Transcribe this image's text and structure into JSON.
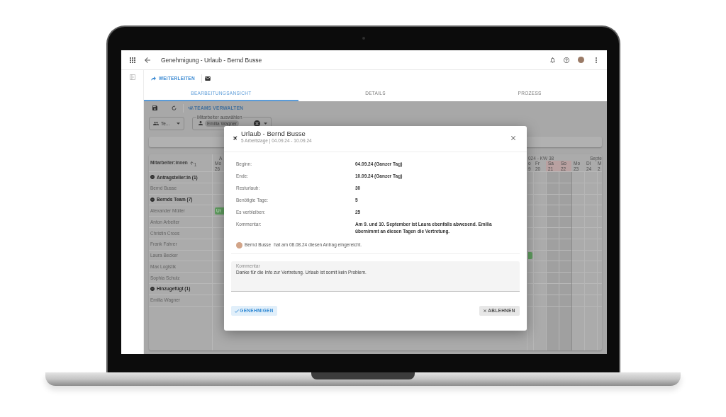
{
  "app_bar": {
    "title": "Genehmigung - Urlaub - Bernd Busse"
  },
  "actions": {
    "forward": "WEITERLEITEN"
  },
  "tabs": [
    {
      "label": "BEARBEITUNGSANSICHT",
      "selected": true
    },
    {
      "label": "DETAILS",
      "selected": false
    },
    {
      "label": "PROZESS",
      "selected": false
    }
  ],
  "toolbar": {
    "manage_teams": "TEAMS VERWALTEN"
  },
  "filters": {
    "team_select": {
      "value": "Te..."
    },
    "employee_select": {
      "label": "Mitarbeiter auswählen",
      "chips": [
        "Emilia Wagner"
      ]
    }
  },
  "table": {
    "column_header": {
      "label": "Mitarbeiter:innen",
      "sort_order": "1"
    },
    "calendar_left": {
      "month": "A",
      "days": [
        {
          "day": "Mo",
          "date": "26",
          "weekend": false
        }
      ]
    },
    "calendar_right": {
      "week": "024 - KW 38",
      "month": "Septe",
      "days": [
        {
          "day": "o",
          "date": "9",
          "weekend": false
        },
        {
          "day": "Fr",
          "date": "20",
          "weekend": false
        },
        {
          "day": "Sa",
          "date": "21",
          "weekend": true
        },
        {
          "day": "So",
          "date": "22",
          "weekend": true
        },
        {
          "day": "Mo",
          "date": "23",
          "weekend": false
        },
        {
          "day": "Di",
          "date": "24",
          "weekend": false
        },
        {
          "day": "M",
          "date": "2",
          "weekend": false
        }
      ]
    },
    "rows": [
      {
        "kind": "group",
        "label": "Antragsteller:in (1)",
        "expanded": true
      },
      {
        "kind": "person",
        "label": "Bernd Busse"
      },
      {
        "kind": "group",
        "label": "Bernds Team (7)",
        "expanded": true
      },
      {
        "kind": "person",
        "label": "Alexander Müller",
        "events": [
          {
            "kind": "start",
            "label": "Ur"
          }
        ]
      },
      {
        "kind": "person",
        "label": "Anton Arbeiter"
      },
      {
        "kind": "person",
        "label": "Christin Croos"
      },
      {
        "kind": "person",
        "label": "Frank Fahrer"
      },
      {
        "kind": "person",
        "label": "Laura Becker",
        "events": [
          {
            "kind": "end"
          }
        ]
      },
      {
        "kind": "person",
        "label": "Max Logistik"
      },
      {
        "kind": "person",
        "label": "Sophia Schulz"
      },
      {
        "kind": "group",
        "label": "Hinzugefügt (1)",
        "expanded": true
      },
      {
        "kind": "person",
        "label": "Emilia Wagner"
      }
    ]
  },
  "dialog": {
    "title": "Urlaub - Bernd Busse",
    "subtitle": "5 Arbeitstage | 04.09.24 - 10.09.24",
    "fields": [
      {
        "label": "Beginn:",
        "value": "04.09.24 (Ganzer Tag)"
      },
      {
        "label": "Ende:",
        "value": "10.09.24 (Ganzer Tag)"
      },
      {
        "label": "Resturlaub:",
        "value": "30"
      },
      {
        "label": "Benötigte Tage:",
        "value": "5"
      },
      {
        "label": "Es verbleiben:",
        "value": "25"
      },
      {
        "label": "Kommentar:",
        "value": "Am 9. und 10. September ist Laura ebenfalls abwesend. Emilia übernimmt an diesen Tagen die Vertretung."
      }
    ],
    "submitted": {
      "name": "Bernd Busse",
      "text": "hat am 08.08.24 diesen Antrag eingereicht."
    },
    "comment": {
      "label": "Kommentar",
      "value": "Danke für die Info zur Vertretung. Urlaub ist somit kein Problem."
    },
    "buttons": [
      {
        "label": "GENEHMIGEN",
        "kind": "approve"
      },
      {
        "label": "ABLEHNEN",
        "kind": "reject"
      }
    ]
  }
}
